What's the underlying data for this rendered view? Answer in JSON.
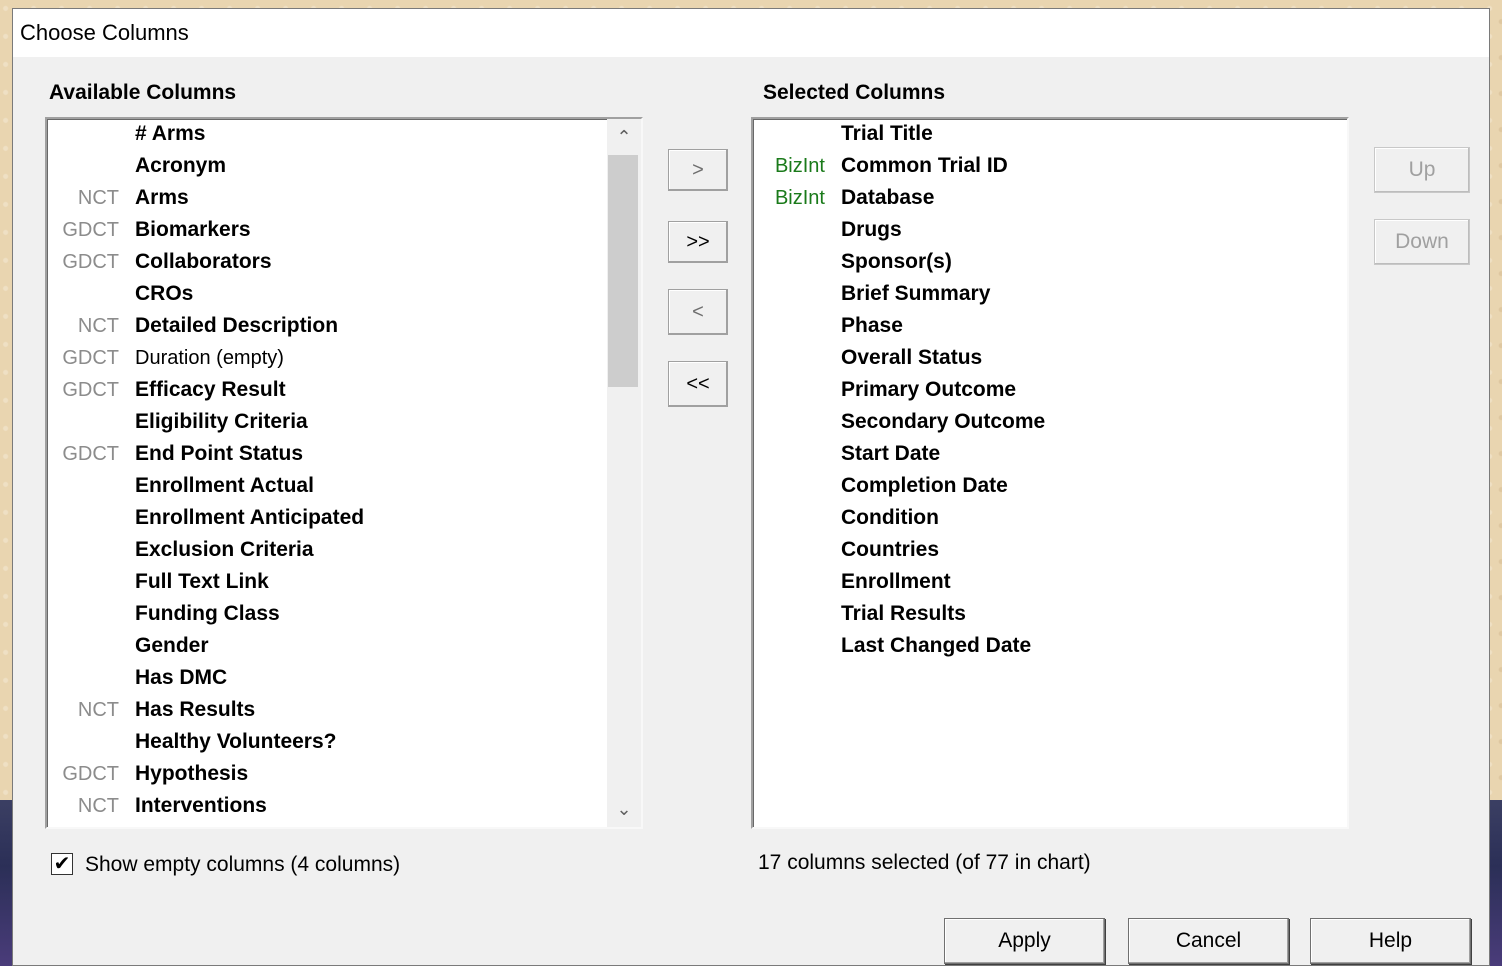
{
  "dialog": {
    "title": "Choose Columns",
    "available_label": "Available Columns",
    "selected_label": "Selected Columns",
    "available_items": [
      {
        "source": "",
        "name": "# Arms",
        "empty": false
      },
      {
        "source": "",
        "name": "Acronym",
        "empty": false
      },
      {
        "source": "NCT",
        "name": "Arms",
        "empty": false
      },
      {
        "source": "GDCT",
        "name": "Biomarkers",
        "empty": false
      },
      {
        "source": "GDCT",
        "name": "Collaborators",
        "empty": false
      },
      {
        "source": "",
        "name": "CROs",
        "empty": false
      },
      {
        "source": "NCT",
        "name": "Detailed Description",
        "empty": false
      },
      {
        "source": "GDCT",
        "name": "Duration (empty)",
        "empty": true
      },
      {
        "source": "GDCT",
        "name": "Efficacy Result",
        "empty": false
      },
      {
        "source": "",
        "name": "Eligibility Criteria",
        "empty": false
      },
      {
        "source": "GDCT",
        "name": "End Point Status",
        "empty": false
      },
      {
        "source": "",
        "name": "Enrollment Actual",
        "empty": false
      },
      {
        "source": "",
        "name": "Enrollment Anticipated",
        "empty": false
      },
      {
        "source": "",
        "name": "Exclusion Criteria",
        "empty": false
      },
      {
        "source": "",
        "name": "Full Text Link",
        "empty": false
      },
      {
        "source": "",
        "name": "Funding Class",
        "empty": false
      },
      {
        "source": "",
        "name": "Gender",
        "empty": false
      },
      {
        "source": "",
        "name": "Has DMC",
        "empty": false
      },
      {
        "source": "NCT",
        "name": "Has Results",
        "empty": false
      },
      {
        "source": "",
        "name": "Healthy Volunteers?",
        "empty": false
      },
      {
        "source": "GDCT",
        "name": "Hypothesis",
        "empty": false
      },
      {
        "source": "NCT",
        "name": "Interventions",
        "empty": false
      }
    ],
    "selected_items": [
      {
        "source": "",
        "name": "Trial Title"
      },
      {
        "source": "BizInt",
        "name": "Common Trial ID"
      },
      {
        "source": "BizInt",
        "name": "Database"
      },
      {
        "source": "",
        "name": "Drugs"
      },
      {
        "source": "",
        "name": "Sponsor(s)"
      },
      {
        "source": "",
        "name": "Brief Summary"
      },
      {
        "source": "",
        "name": "Phase"
      },
      {
        "source": "",
        "name": "Overall Status"
      },
      {
        "source": "",
        "name": "Primary Outcome"
      },
      {
        "source": "",
        "name": "Secondary Outcome"
      },
      {
        "source": "",
        "name": "Start Date"
      },
      {
        "source": "",
        "name": "Completion Date"
      },
      {
        "source": "",
        "name": "Condition"
      },
      {
        "source": "",
        "name": "Countries"
      },
      {
        "source": "",
        "name": "Enrollment"
      },
      {
        "source": "",
        "name": "Trial Results"
      },
      {
        "source": "",
        "name": "Last Changed Date"
      }
    ],
    "move_buttons": {
      "add": ">",
      "add_all": ">>",
      "remove": "<",
      "remove_all": "<<"
    },
    "order_buttons": {
      "up": "Up",
      "down": "Down"
    },
    "show_empty": {
      "checked": true,
      "check_glyph": "✔",
      "label": "Show empty columns  (4 columns)"
    },
    "selected_count_text": "17 columns selected (of 77 in chart)",
    "footer_buttons": {
      "apply": "Apply",
      "cancel": "Cancel",
      "help": "Help"
    },
    "scroll_icons": {
      "up": "⌃",
      "down": "⌄"
    },
    "colors": {
      "source_gray": "#8c8c8c",
      "source_green": "#1a7a1a"
    }
  }
}
